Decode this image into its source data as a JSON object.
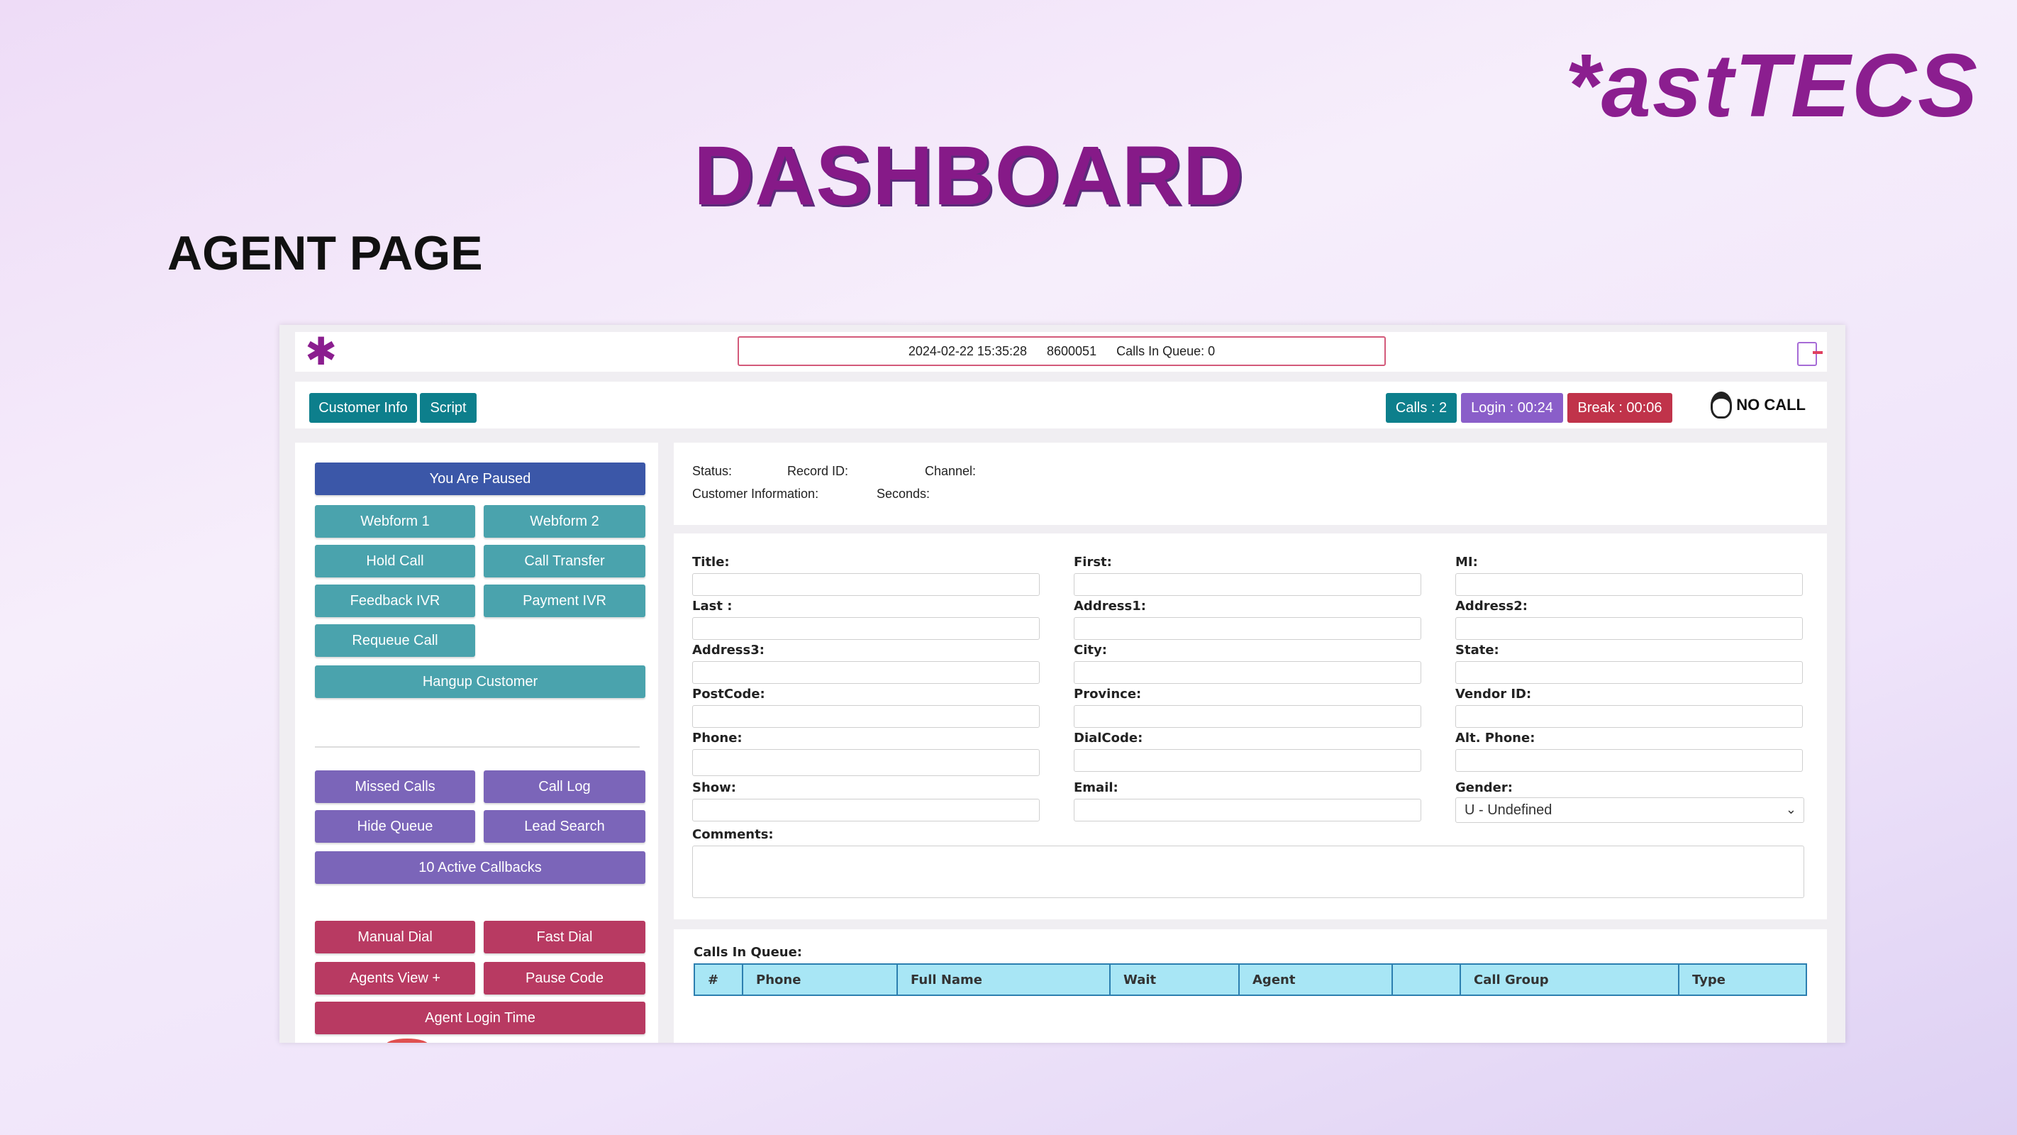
{
  "slide": {
    "brand": "*astTECS",
    "title": "DASHBOARD",
    "subtitle": "AGENT PAGE"
  },
  "topbar": {
    "logo_icon": "asterisk-logo-icon",
    "datetime": "2024-02-22 15:35:28",
    "extension": "8600051",
    "calls_in_queue": "Calls In Queue: 0",
    "logout_icon": "logout-icon"
  },
  "toolbar": {
    "customer_info": "Customer Info",
    "script": "Script",
    "calls": "Calls : 2",
    "login": "Login : 00:24",
    "break": "Break : 00:06",
    "no_call": "NO CALL",
    "colors": {
      "teal": "#0d7f8c",
      "purple": "#8a5ec9",
      "red": "#c0334a"
    }
  },
  "left": {
    "paused": "You Are Paused",
    "webform1": "Webform 1",
    "webform2": "Webform 2",
    "hold_call": "Hold Call",
    "call_transfer": "Call Transfer",
    "feedback_ivr": "Feedback IVR",
    "payment_ivr": "Payment IVR",
    "requeue_call": "Requeue Call",
    "hangup_customer": "Hangup Customer",
    "missed_calls": "Missed Calls",
    "call_log": "Call Log",
    "hide_queue": "Hide Queue",
    "lead_search": "Lead Search",
    "active_callbacks": "10 Active Callbacks",
    "manual_dial": "Manual Dial",
    "fast_dial": "Fast Dial",
    "agents_view": "Agents View +",
    "pause_code": "Pause Code",
    "agent_login_time": "Agent Login Time"
  },
  "info": {
    "status": "Status:",
    "record_id": "Record ID:",
    "channel": "Channel:",
    "customer_information": "Customer Information:",
    "seconds": "Seconds:"
  },
  "form": {
    "title": "Title:",
    "first": "First:",
    "mi": "MI:",
    "last": "Last :",
    "address1": "Address1:",
    "address2": "Address2:",
    "address3": "Address3:",
    "city": "City:",
    "state": "State:",
    "postcode": "PostCode:",
    "province": "Province:",
    "vendor_id": "Vendor ID:",
    "phone": "Phone:",
    "dialcode": "DialCode:",
    "alt_phone": "Alt. Phone:",
    "show": "Show:",
    "email": "Email:",
    "gender": "Gender:",
    "gender_value": "U - Undefined",
    "comments": "Comments:"
  },
  "queue": {
    "label": "Calls In Queue:",
    "columns": [
      "#",
      "Phone",
      "Full Name",
      "Wait",
      "Agent",
      "",
      "Call Group",
      "Type"
    ]
  }
}
